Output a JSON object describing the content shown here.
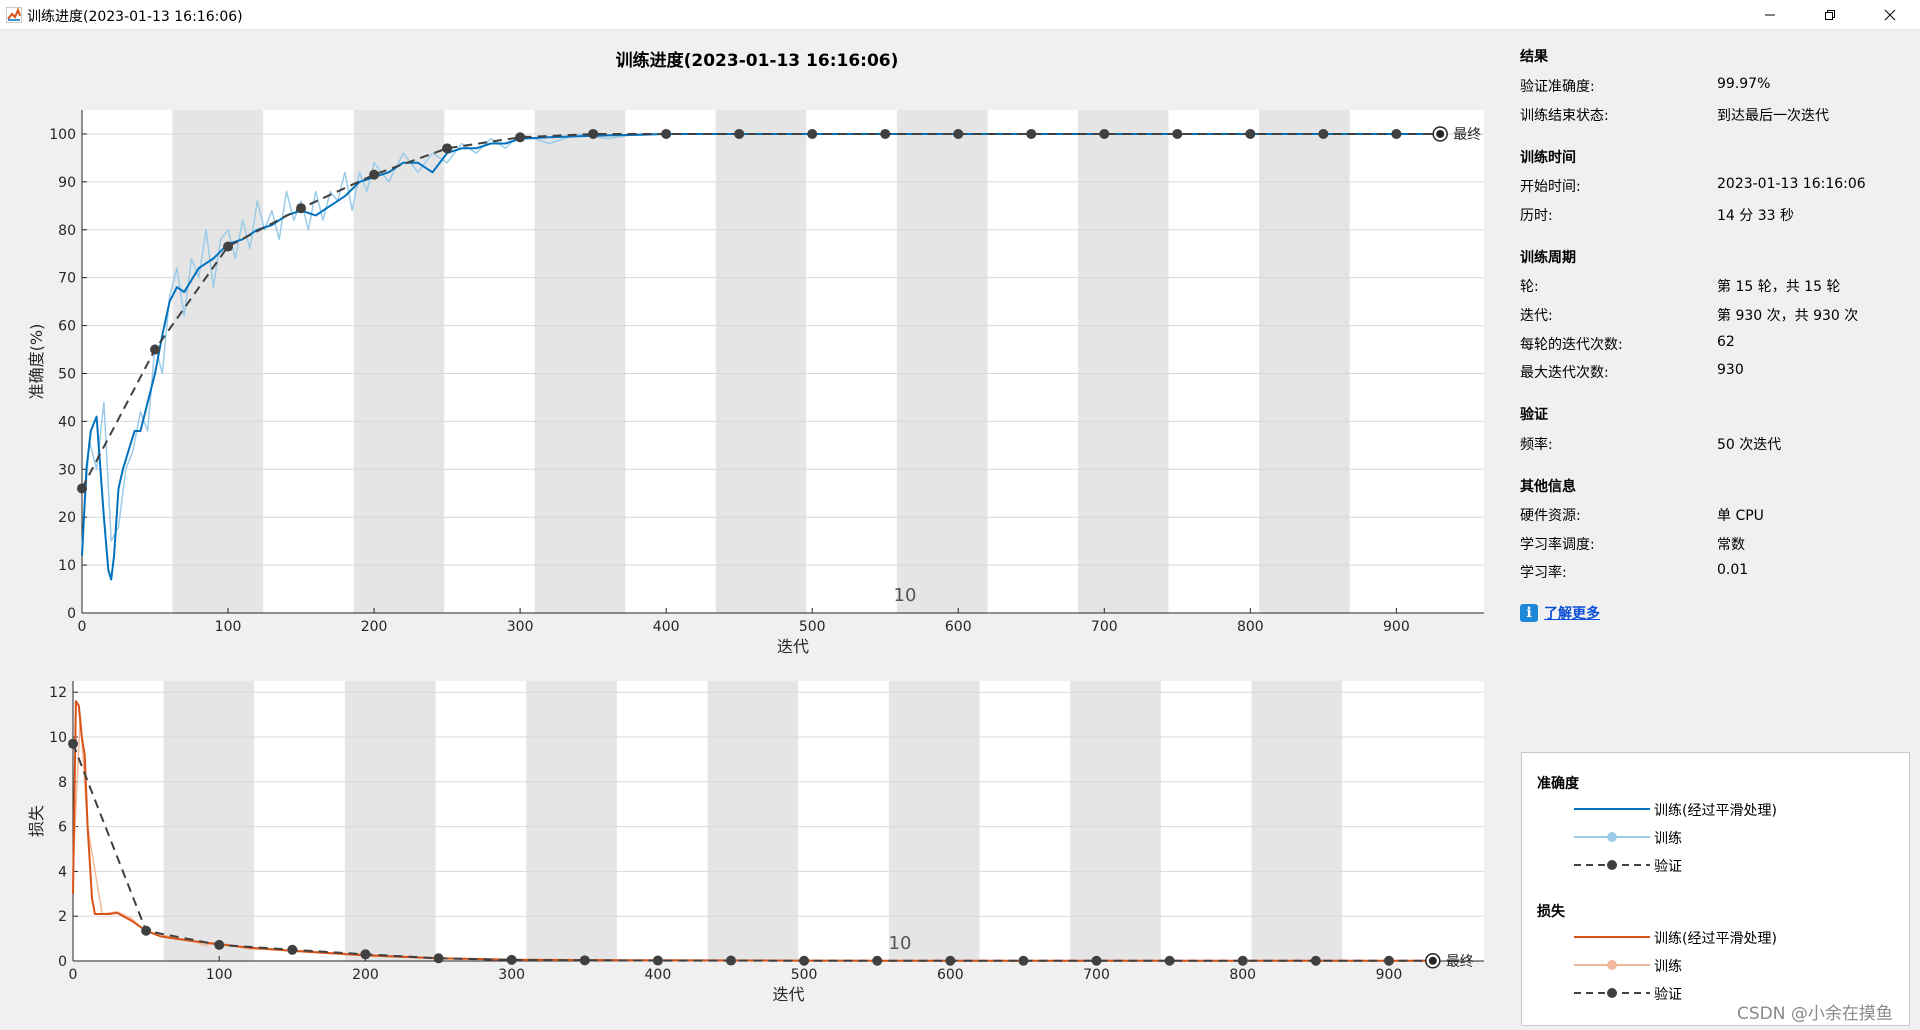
{
  "window": {
    "title": "训练进度(2023-01-13 16:16:06)",
    "controls": [
      "minimize-icon",
      "restore-icon",
      "close-icon"
    ]
  },
  "colors": {
    "accuracy_smoothed": "#0072bd",
    "accuracy_raw": "#9ccbe8",
    "loss_smoothed": "#d95319",
    "loss_raw": "#f2b89c",
    "validation": "#404040",
    "epoch_shade": "#e5e5e5"
  },
  "chart_data": [
    {
      "type": "line",
      "title": "训练进度(2023-01-13 16:16:06)",
      "xlabel": "迭代",
      "ylabel": "准确度(%)",
      "xlim": [
        0,
        960
      ],
      "ylim": [
        0,
        105
      ],
      "xticks": [
        0,
        100,
        200,
        300,
        400,
        500,
        600,
        700,
        800,
        900
      ],
      "yticks": [
        0,
        10,
        20,
        30,
        40,
        50,
        60,
        70,
        80,
        90,
        100
      ],
      "grid": true,
      "epoch_label": "10",
      "final_label": "最终",
      "series": [
        {
          "name": "训练(经过平滑处理)",
          "x": [
            0,
            3,
            6,
            10,
            15,
            18,
            20,
            22,
            25,
            28,
            32,
            36,
            40,
            45,
            50,
            55,
            60,
            65,
            70,
            80,
            90,
            100,
            110,
            120,
            130,
            140,
            150,
            160,
            170,
            180,
            190,
            200,
            210,
            220,
            230,
            240,
            250,
            260,
            270,
            280,
            290,
            300,
            320,
            340,
            360,
            380,
            400,
            450,
            500,
            550,
            600,
            650,
            700,
            750,
            800,
            850,
            900,
            930
          ],
          "y": [
            12,
            30,
            38,
            41,
            20,
            9,
            7,
            12,
            26,
            30,
            34,
            38,
            38,
            44,
            50,
            58,
            65,
            68,
            67,
            72,
            74,
            77,
            78,
            80,
            81,
            83,
            84,
            83,
            85,
            87,
            90,
            91,
            92,
            94,
            94,
            92,
            96,
            97,
            97,
            98,
            98,
            99,
            99.3,
            99.5,
            99.7,
            99.8,
            100,
            100,
            100,
            100,
            100,
            100,
            100,
            100,
            100,
            100,
            100,
            100
          ]
        },
        {
          "name": "训练",
          "x": [
            0,
            5,
            10,
            15,
            20,
            25,
            30,
            35,
            40,
            45,
            50,
            55,
            60,
            65,
            70,
            75,
            80,
            85,
            90,
            95,
            100,
            105,
            110,
            115,
            120,
            125,
            130,
            135,
            140,
            145,
            150,
            155,
            160,
            165,
            170,
            175,
            180,
            185,
            190,
            195,
            200,
            210,
            220,
            230,
            240,
            250,
            260,
            270,
            280,
            290,
            300,
            320,
            340,
            360,
            380,
            400,
            450,
            500,
            600,
            700,
            800,
            900,
            930
          ],
          "y": [
            14,
            36,
            30,
            44,
            15,
            18,
            30,
            34,
            42,
            38,
            56,
            50,
            66,
            72,
            62,
            74,
            70,
            80,
            68,
            78,
            80,
            74,
            82,
            76,
            86,
            80,
            84,
            78,
            88,
            82,
            86,
            80,
            88,
            82,
            88,
            86,
            92,
            84,
            92,
            88,
            94,
            90,
            96,
            92,
            96,
            94,
            98,
            96,
            99,
            97,
            100,
            98,
            100,
            99,
            100,
            100,
            100,
            100,
            100,
            100,
            100,
            100,
            100
          ]
        },
        {
          "name": "验证",
          "x": [
            0,
            50,
            100,
            150,
            200,
            250,
            300,
            350,
            400,
            450,
            500,
            550,
            600,
            650,
            700,
            750,
            800,
            850,
            900,
            930
          ],
          "y": [
            26,
            55,
            76.5,
            84.5,
            91.5,
            97,
            99.3,
            100,
            100,
            100,
            100,
            100,
            100,
            100,
            100,
            100,
            100,
            100,
            100,
            100
          ]
        }
      ]
    },
    {
      "type": "line",
      "xlabel": "迭代",
      "ylabel": "损失",
      "xlim": [
        0,
        965
      ],
      "ylim": [
        0,
        12.5
      ],
      "xticks": [
        0,
        100,
        200,
        300,
        400,
        500,
        600,
        700,
        800,
        900
      ],
      "yticks": [
        0,
        2,
        4,
        6,
        8,
        10,
        12
      ],
      "grid": true,
      "epoch_label": "10",
      "final_label": "最终",
      "series": [
        {
          "name": "训练(经过平滑处理)",
          "x": [
            0,
            2,
            4,
            6,
            8,
            10,
            13,
            15,
            20,
            25,
            30,
            40,
            50,
            60,
            80,
            100,
            120,
            150,
            200,
            250,
            300,
            400,
            500,
            600,
            700,
            800,
            900,
            930
          ],
          "y": [
            3,
            11.6,
            11.4,
            10,
            9.2,
            6,
            2.8,
            2.1,
            2.1,
            2.1,
            2.15,
            1.8,
            1.35,
            1.1,
            0.9,
            0.75,
            0.6,
            0.45,
            0.25,
            0.12,
            0.06,
            0.03,
            0.02,
            0.01,
            0.01,
            0.01,
            0.01,
            0.01
          ]
        },
        {
          "name": "训练",
          "x": [
            0,
            5,
            10,
            20,
            30,
            40,
            50,
            60,
            70,
            80,
            90,
            100,
            120,
            140,
            160,
            180,
            200,
            250,
            300,
            400,
            500,
            600,
            700,
            800,
            900,
            930
          ],
          "y": [
            4,
            11,
            6,
            2.1,
            2.2,
            1.9,
            1.3,
            1.2,
            1.0,
            0.95,
            0.7,
            0.8,
            0.55,
            0.5,
            0.45,
            0.35,
            0.3,
            0.12,
            0.05,
            0.02,
            0.01,
            0.01,
            0.01,
            0.01,
            0.01,
            0.01
          ]
        },
        {
          "name": "验证",
          "x": [
            0,
            50,
            100,
            150,
            200,
            250,
            300,
            350,
            400,
            450,
            500,
            550,
            600,
            650,
            700,
            750,
            800,
            850,
            900,
            930
          ],
          "y": [
            9.7,
            1.35,
            0.72,
            0.5,
            0.3,
            0.12,
            0.05,
            0.03,
            0.02,
            0.02,
            0.01,
            0.01,
            0.01,
            0.01,
            0.01,
            0.01,
            0.01,
            0.01,
            0.01,
            0.01
          ]
        }
      ]
    }
  ],
  "epochs": {
    "iterations_per_epoch": 62,
    "count": 15
  },
  "info_panel": {
    "results": {
      "title": "结果",
      "rows": [
        {
          "label": "验证准确度:",
          "value": "99.97%"
        },
        {
          "label": "训练结束状态:",
          "value": "到达最后一次迭代"
        }
      ]
    },
    "training_time": {
      "title": "训练时间",
      "rows": [
        {
          "label": "开始时间:",
          "value": "2023-01-13 16:16:06"
        },
        {
          "label": "历时:",
          "value": "14 分 33 秒"
        }
      ]
    },
    "training_cycle": {
      "title": "训练周期",
      "rows": [
        {
          "label": "轮:",
          "value": "第 15 轮，共 15 轮"
        },
        {
          "label": "迭代:",
          "value": "第 930 次，共 930 次"
        },
        {
          "label": "每轮的迭代次数:",
          "value": "62"
        },
        {
          "label": "最大迭代次数:",
          "value": "930"
        }
      ]
    },
    "validation": {
      "title": "验证",
      "rows": [
        {
          "label": "频率:",
          "value": "50 次迭代"
        }
      ]
    },
    "other": {
      "title": "其他信息",
      "rows": [
        {
          "label": "硬件资源:",
          "value": "单 CPU"
        },
        {
          "label": "学习率调度:",
          "value": "常数"
        },
        {
          "label": "学习率:",
          "value": "0.01"
        }
      ]
    },
    "learn_more": "了解更多",
    "learn_more_icon": "info-icon"
  },
  "legend": {
    "accuracy_title": "准确度",
    "loss_title": "损失",
    "smoothed": "训练(经过平滑处理)",
    "training": "训练",
    "validation": "验证"
  },
  "watermark": "CSDN @小余在摸鱼"
}
